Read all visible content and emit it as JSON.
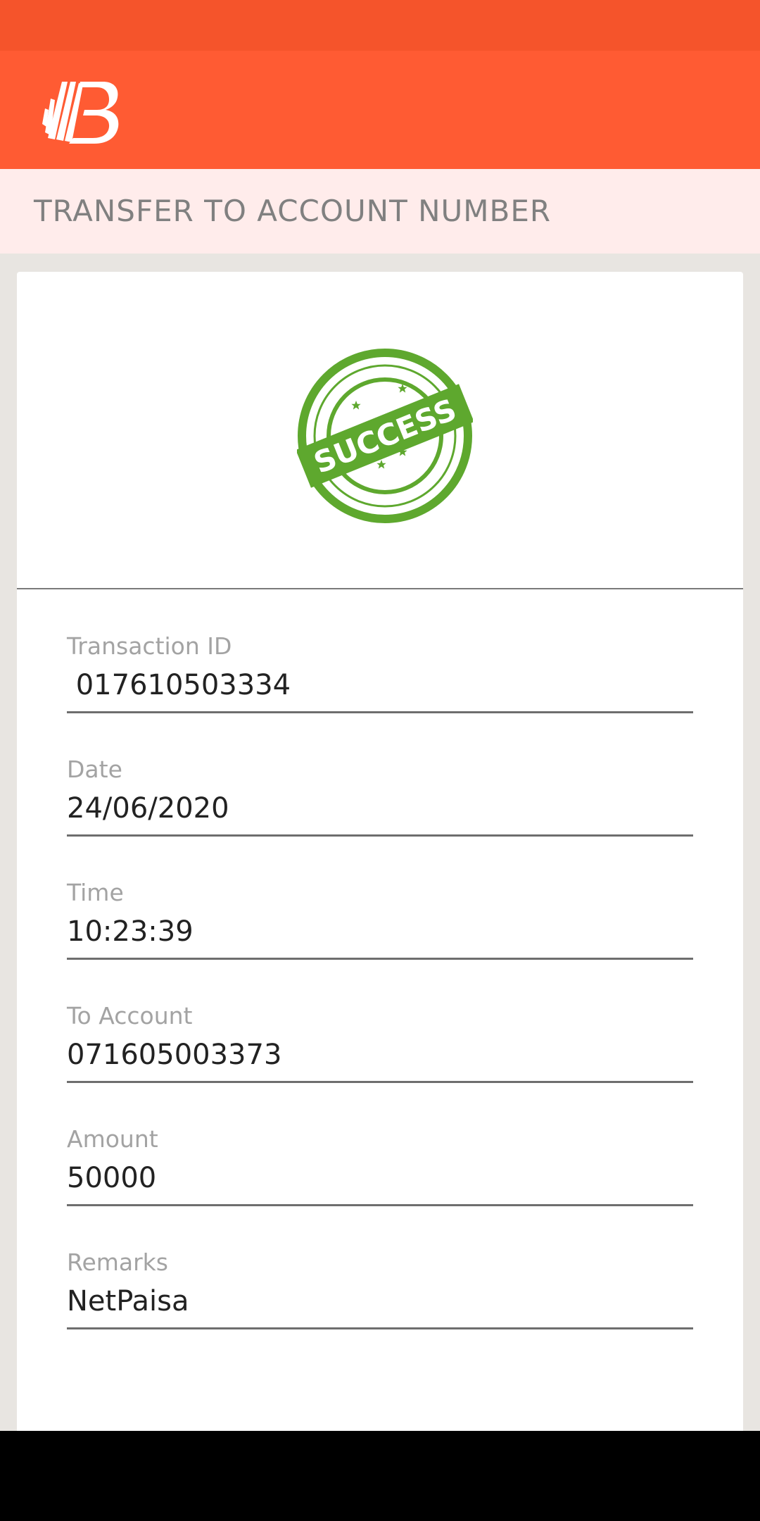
{
  "colors": {
    "status_bar": "#f5542b",
    "app_bar": "#ff5b33",
    "title_bar_bg": "#ffeceb",
    "success_green": "#5ea82e"
  },
  "header": {
    "logo_icon": "bank-of-baroda-logo-icon"
  },
  "page": {
    "title": "TRANSFER TO ACCOUNT NUMBER"
  },
  "status": {
    "stamp_text": "SUCCESS",
    "icon": "success-stamp-icon"
  },
  "fields": [
    {
      "label": "Transaction ID",
      "value": " 017610503334"
    },
    {
      "label": "Date",
      "value": "24/06/2020"
    },
    {
      "label": "Time",
      "value": "10:23:39"
    },
    {
      "label": "To Account",
      "value": "071605003373"
    },
    {
      "label": "Amount",
      "value": "50000"
    },
    {
      "label": "Remarks",
      "value": "NetPaisa"
    }
  ]
}
